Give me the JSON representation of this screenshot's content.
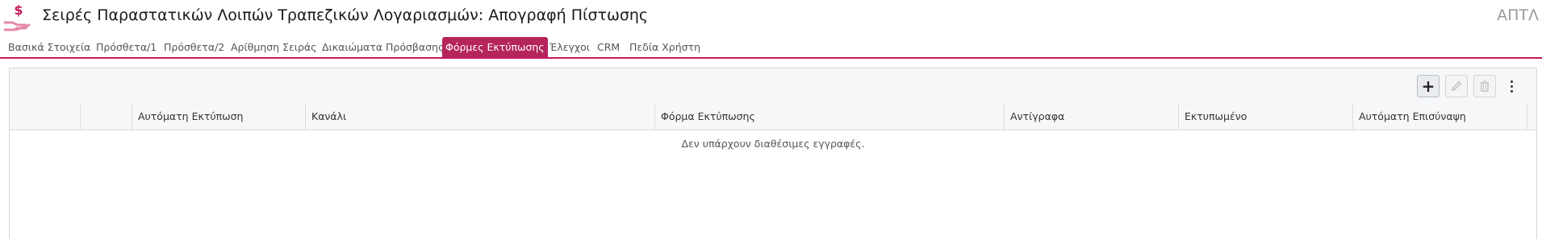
{
  "header": {
    "title": "Σειρές Παραστατικών Λοιπών Τραπεζικών Λογαριασμών: Απογραφή Πίστωσης",
    "code": "ΑΠΤΛ",
    "icon": "hand-money-icon",
    "accent_color": "#c2185b"
  },
  "tabs": [
    {
      "label": "Βασικά Στοιχεία",
      "active": false
    },
    {
      "label": "Πρόσθετα/1",
      "active": false
    },
    {
      "label": "Πρόσθετα/2",
      "active": false
    },
    {
      "label": "Αρίθμηση Σειράς",
      "active": false
    },
    {
      "label": "Δικαιώματα Πρόσβασης",
      "active": false
    },
    {
      "label": "Φόρμες Εκτύπωσης",
      "active": true
    },
    {
      "label": "Έλεγχοι",
      "active": false
    },
    {
      "label": "CRM",
      "active": false
    },
    {
      "label": "Πεδία Χρήστη",
      "active": false
    }
  ],
  "toolbar": {
    "add_label": "+",
    "buttons": [
      "plus-icon",
      "pencil-icon",
      "trash-icon",
      "more-vertical-icon"
    ]
  },
  "grid": {
    "columns": [
      "",
      "",
      "Αυτόματη Εκτύπωση",
      "Κανάλι",
      "Φόρμα Εκτύπωσης",
      "Αντίγραφα",
      "Εκτυπωμένο",
      "Αυτόματη Επισύναψη",
      ""
    ],
    "rows": [],
    "empty_message": "Δεν υπάρχουν διαθέσιμες εγγραφές."
  }
}
